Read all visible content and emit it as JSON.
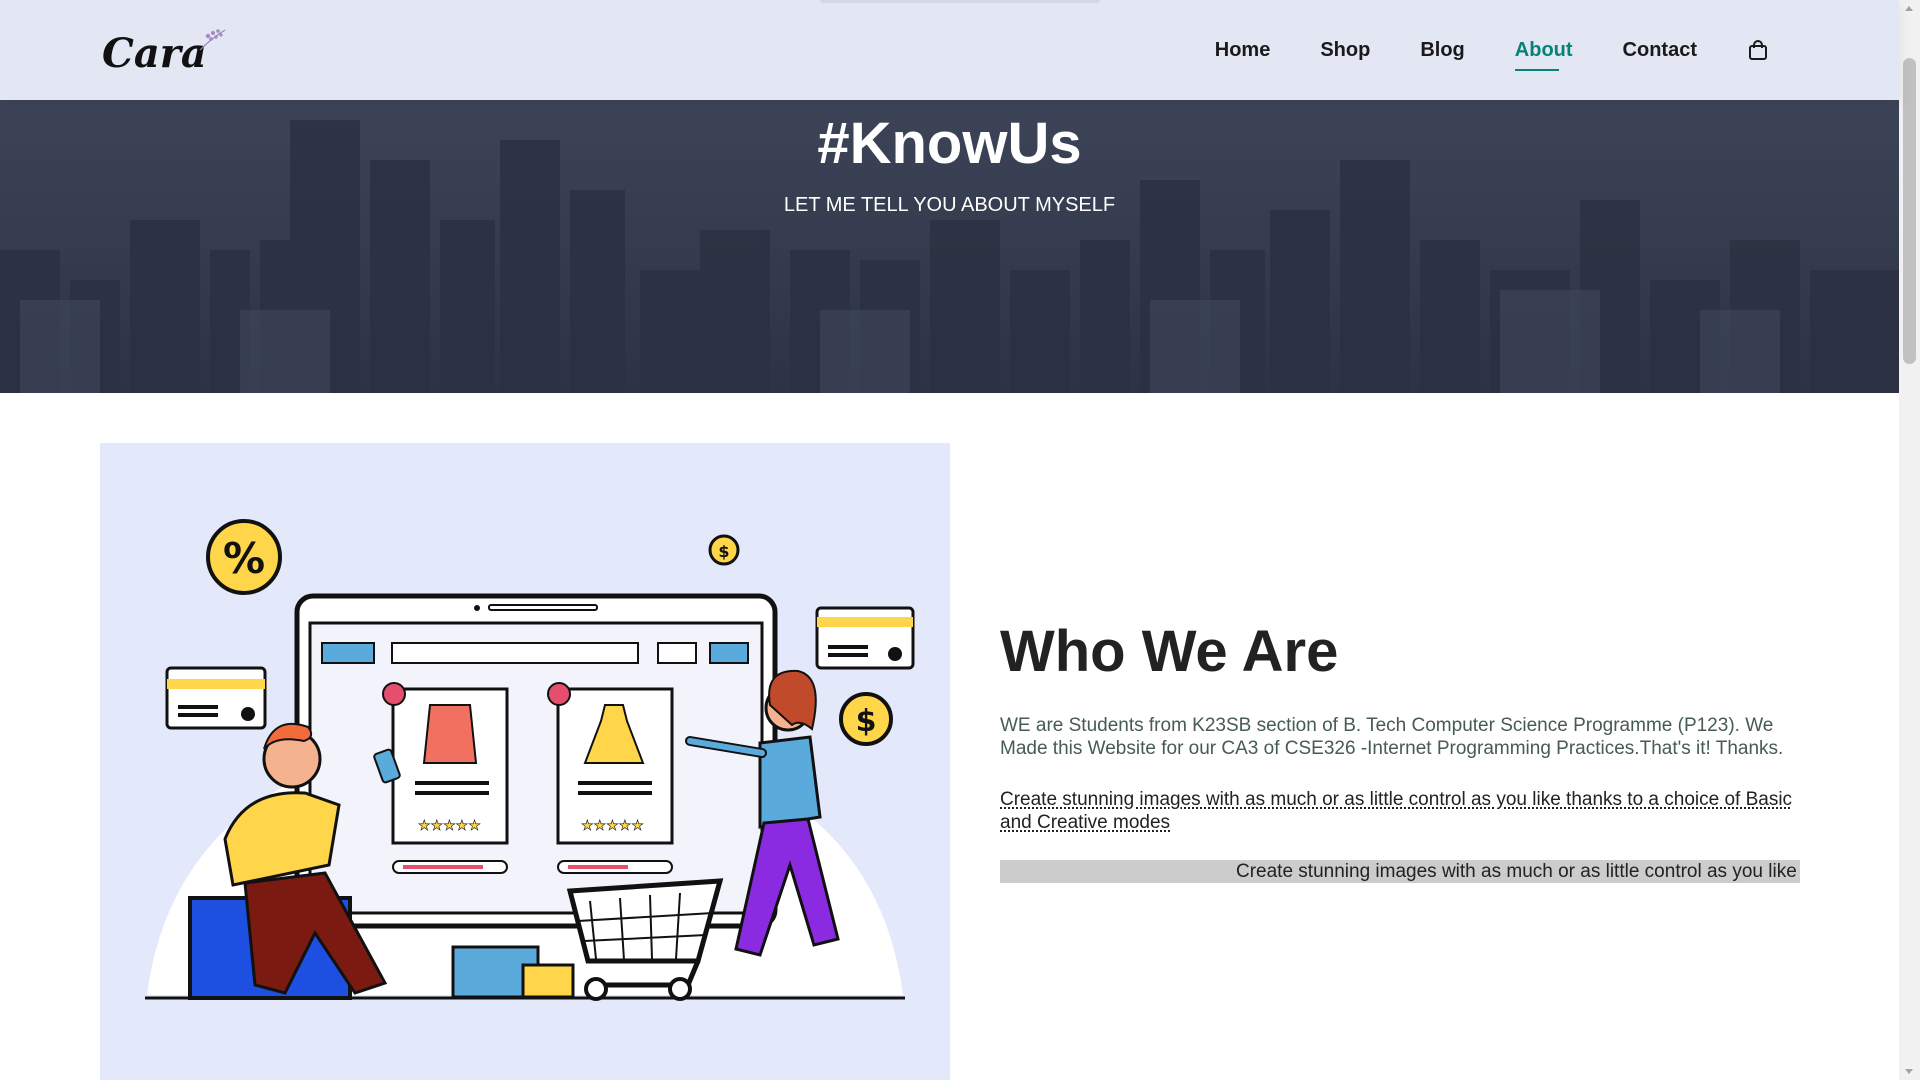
{
  "header": {
    "logo_text": "Cara",
    "nav": [
      {
        "label": "Home",
        "active": false
      },
      {
        "label": "Shop",
        "active": false
      },
      {
        "label": "Blog",
        "active": false
      },
      {
        "label": "About",
        "active": true
      },
      {
        "label": "Contact",
        "active": false
      }
    ],
    "cart_icon": "shopping-bag-icon"
  },
  "hero": {
    "title": "#KnowUs",
    "subtitle": "LET ME TELL YOU ABOUT MYSELF"
  },
  "about": {
    "heading": "Who We Are",
    "description": "WE are Students from K23SB section of B. Tech Computer Science Programme (P123). We Made this Website for our CA3 of CSE326 -Internet Programming Practices.That's it! Thanks.",
    "abbr_text": "Create stunning images with as much or as little control as you like thanks to a choice of Basic and Creative modes",
    "marquee_text": "Create stunning images with as much or as little control as you like thanks to a choice of Basic and Creative modes"
  },
  "illustration": {
    "percent_symbol": "%",
    "dollar_symbol": "$"
  },
  "colors": {
    "header_bg": "#e3e6f3",
    "accent": "#088178",
    "hero_bg": "#363d50",
    "illustration_bg": "#e3e9fb",
    "marquee_bg": "#cccccc"
  }
}
